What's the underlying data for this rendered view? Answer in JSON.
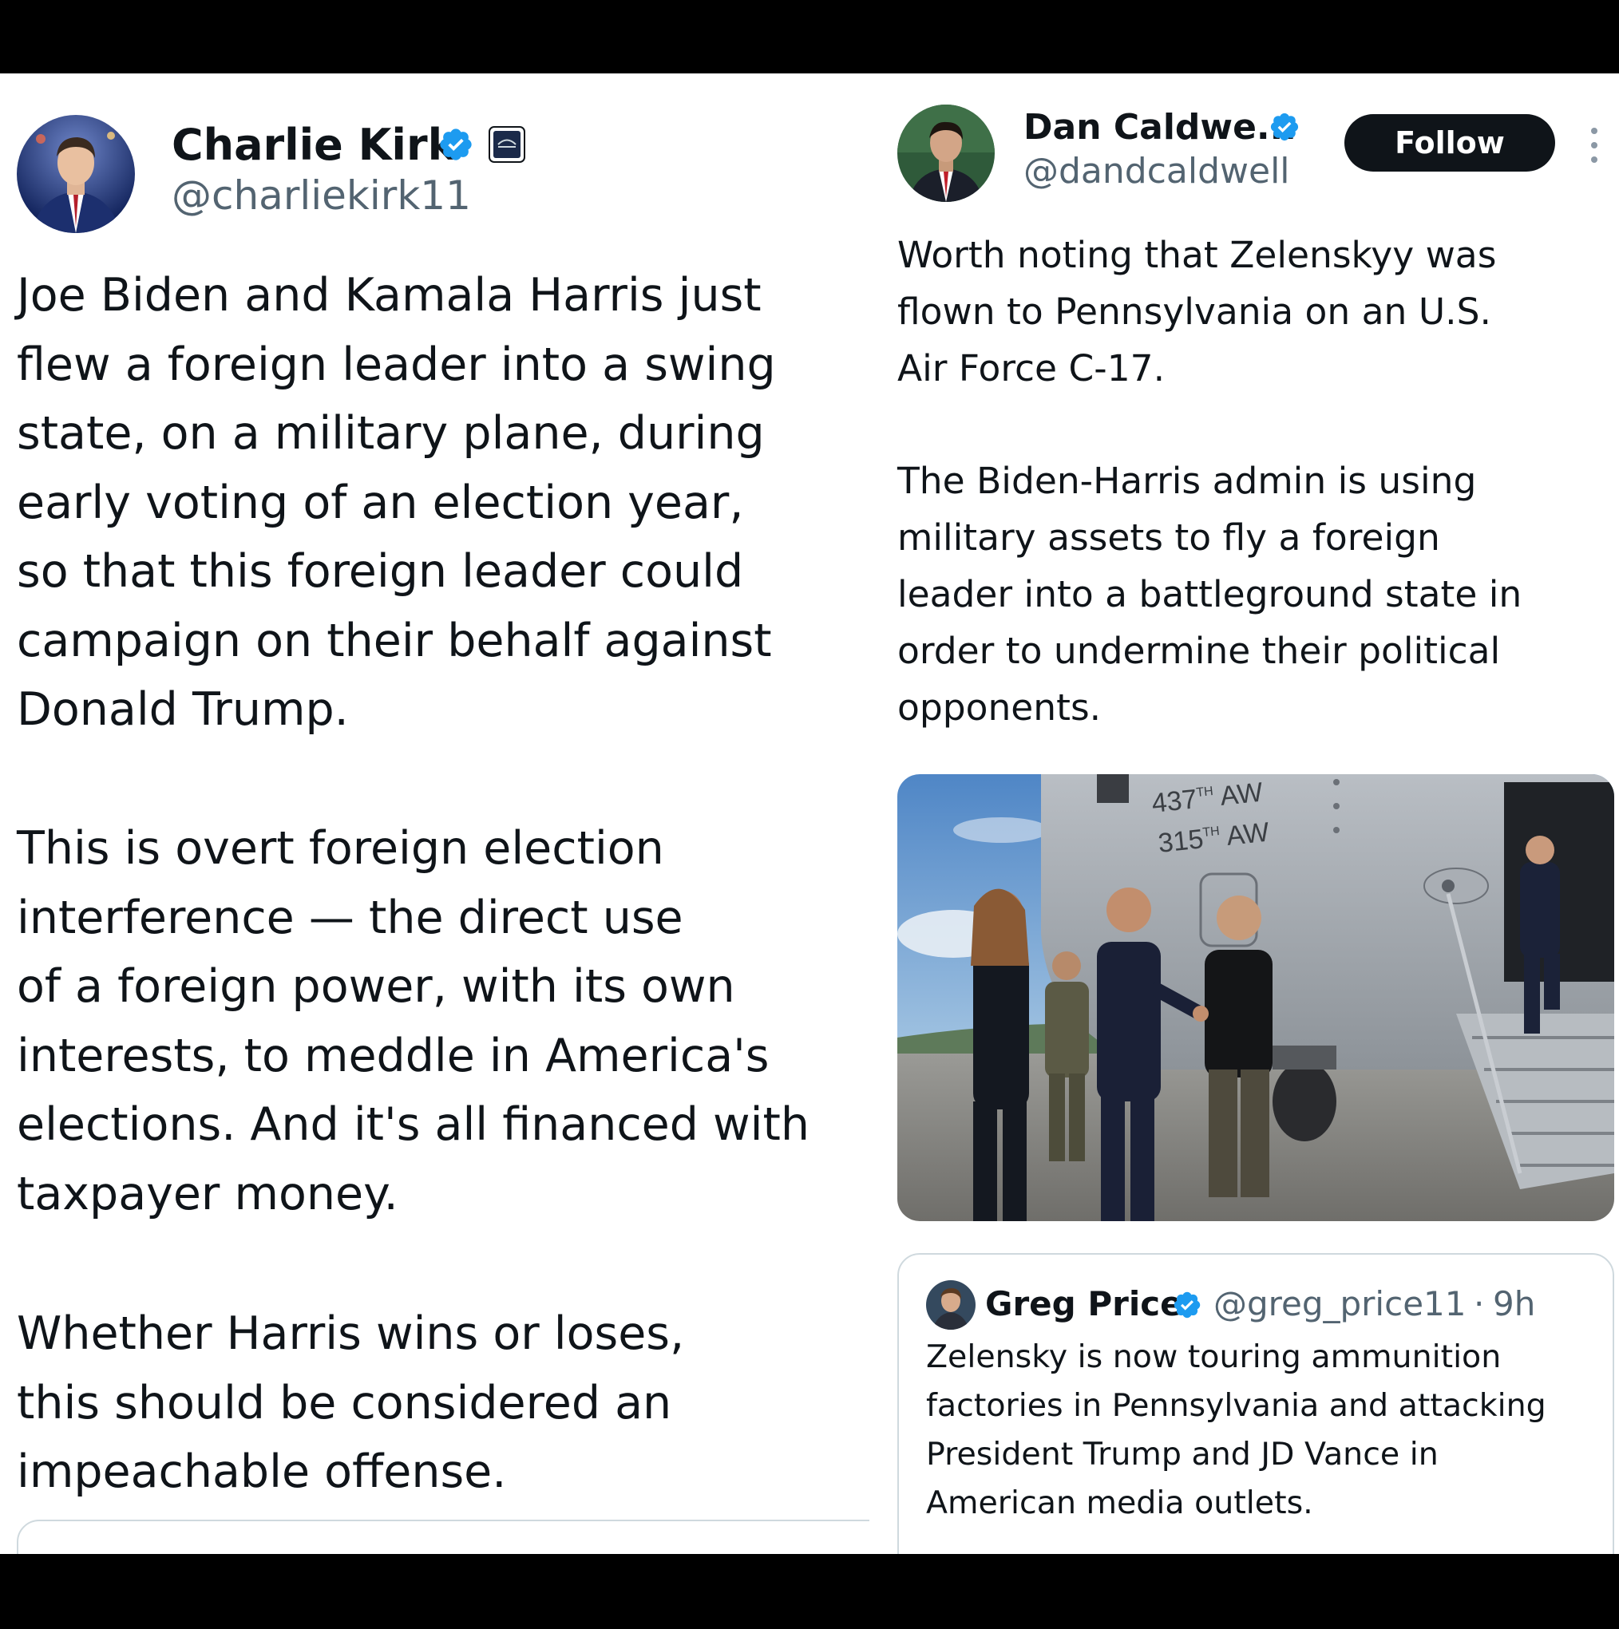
{
  "left_tweet": {
    "author_name": "Charlie Kirk",
    "handle": "@charliekirk11",
    "badge_icon": "affiliate-badge-icon",
    "paragraphs": [
      "Joe Biden and Kamala Harris just\nflew a foreign leader into a swing\nstate, on a military plane, during\nearly voting of an election year,\nso that this foreign leader could\ncampaign on their behalf against\nDonald Trump.",
      "This is overt foreign election\ninterference — the direct use\nof a foreign power, with its own\ninterests, to meddle in America's\nelections. And it's all financed with\ntaxpayer money.",
      "Whether Harris wins or loses,\nthis should be considered an\nimpeachable offense."
    ]
  },
  "right_tweet": {
    "author_name": "Dan Caldwe...",
    "handle": "@dandcaldwell",
    "follow_label": "Follow",
    "paragraphs": [
      "Worth noting that Zelenskyy was\nflown to Pennsylvania on an U.S.\nAir Force C-17.",
      "The Biden-Harris admin is using\nmilitary assets to fly a foreign\nleader into a battleground state in\norder to undermine their political\nopponents."
    ],
    "photo": {
      "fuselage_text_1": "437",
      "fuselage_sup_1": "TH",
      "fuselage_unit_1": "AW",
      "fuselage_text_2": "315",
      "fuselage_sup_2": "TH",
      "fuselage_unit_2": "AW"
    },
    "quoted_tweet": {
      "author_name": "Greg Price",
      "handle": "@greg_price11",
      "separator": "·",
      "time": "9h",
      "text": "Zelensky is now touring ammunition\nfactories in Pennsylvania and attacking\nPresident Trump and JD Vance in\nAmerican media outlets."
    }
  },
  "colors": {
    "verified": "#1d9bf0",
    "handle_gray": "#536471",
    "text": "#0f1419",
    "background_bars": "#000000"
  }
}
